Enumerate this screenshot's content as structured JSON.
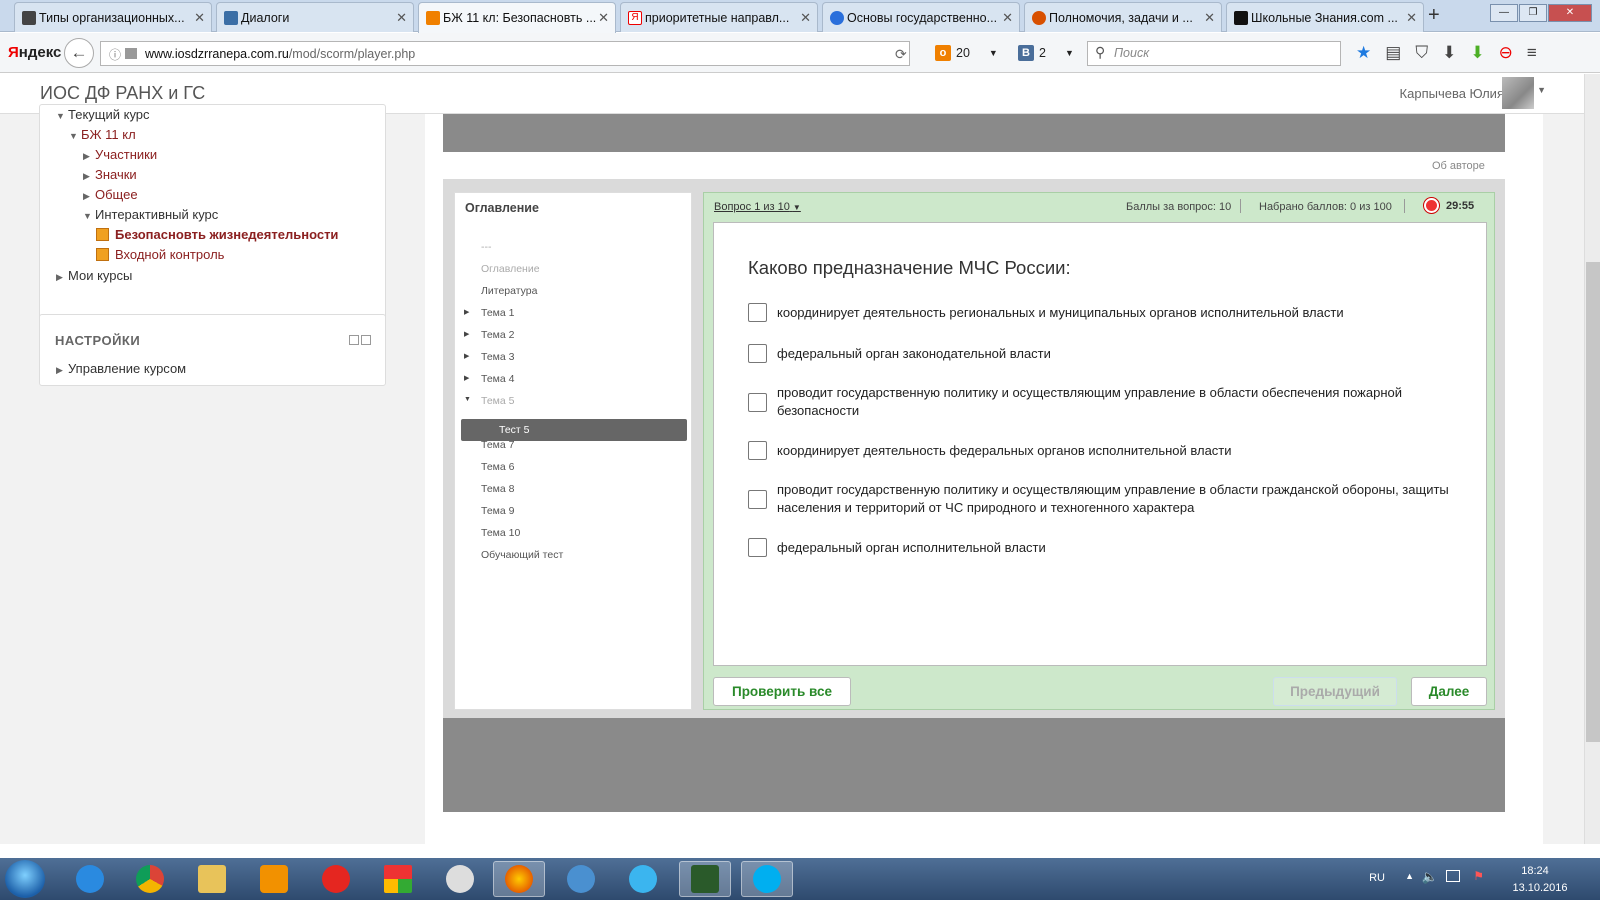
{
  "browser": {
    "tabs": [
      {
        "label": "Типы организационных...",
        "color": "#444"
      },
      {
        "label": "Диалоги",
        "color": "#3b6ea5"
      },
      {
        "label": "БЖ 11 кл: Безопасновть ...",
        "color": "#f08000",
        "active": true
      },
      {
        "label": "приоритетные направл...",
        "color": "#e00"
      },
      {
        "label": "Основы государственно...",
        "color": "#2a6fdb"
      },
      {
        "label": "Полномочия, задачи и ...",
        "color": "#d85000"
      },
      {
        "label": "Школьные Знания.com ...",
        "color": "#111"
      }
    ],
    "new_tab": "+",
    "yandex_logo_first": "Я",
    "yandex_logo_rest": "ндекс",
    "url_domain": "www.iosdzrranepa.com.ru",
    "url_path": "/mod/scorm/player.php",
    "counter1": "20",
    "counter2": "2",
    "search_placeholder": "Поиск"
  },
  "site": {
    "brand": "ИОС ДФ РАНХ и ГС",
    "user_name": "Карпычева Юлия"
  },
  "nav_block": {
    "items": [
      {
        "label": "Текущий курс"
      },
      {
        "label": "БЖ 11 кл"
      },
      {
        "label": "Участники"
      },
      {
        "label": "Значки"
      },
      {
        "label": "Общее"
      },
      {
        "label": "Интерактивный курс"
      },
      {
        "label": "Безопасновть жизнедеятельности"
      },
      {
        "label": "Входной контроль"
      },
      {
        "label": "Мои курсы"
      }
    ]
  },
  "settings_block": {
    "title": "НАСТРОЙКИ",
    "item": "Управление курсом"
  },
  "player": {
    "about_author": "Об авторе",
    "toc_title": "Оглавление",
    "toc_items": [
      "---",
      "Оглавление",
      "Литература",
      "Тема 1",
      "Тема 2",
      "Тема 3",
      "Тема 4",
      "Тема 5",
      "Тест 5",
      "Тема 7",
      "Тема 6",
      "Тема 8",
      "Тема 9",
      "Тема 10",
      "Обучающий тест"
    ],
    "question_counter": "Вопрос 1 из 10",
    "points_per_question": "Баллы за вопрос: 10",
    "points_total": "Набрано баллов: 0 из 100",
    "timer": "29:55",
    "question": "Каково предназначение МЧС России:",
    "options": [
      "координирует деятельность региональных и муниципальных органов исполнительной власти",
      "федеральный орган законодательной власти",
      "проводит государственную политику и осуществляющим управление в области обеспечения пожарной безопасности",
      "координирует деятельность федеральных органов исполнительной власти",
      "проводит государственную политику и осуществляющим управление в области гражданской обороны, защиты населения и территорий от ЧС природного и техногенного характера",
      "федеральный орган исполнительной власти"
    ],
    "check_all": "Проверить все",
    "previous": "Предыдущий",
    "next": "Далее"
  },
  "taskbar": {
    "lang": "RU",
    "time": "18:24",
    "date": "13.10.2016"
  }
}
